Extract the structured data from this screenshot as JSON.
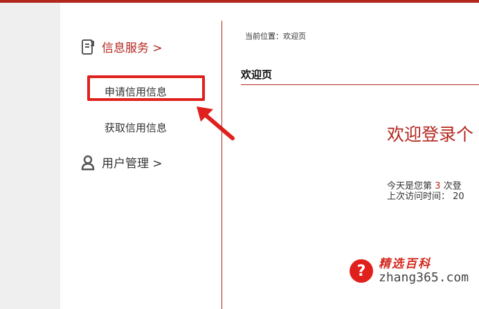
{
  "sidebar": {
    "groups": [
      {
        "label": "信息服务 >",
        "icon": "document-icon"
      },
      {
        "label": "用户管理 >",
        "icon": "user-icon"
      }
    ],
    "items": [
      {
        "label": "申请信用信息"
      },
      {
        "label": "获取信用信息"
      }
    ]
  },
  "main": {
    "breadcrumb": "当前位置：欢迎页",
    "page_title": "欢迎页",
    "welcome_heading": "欢迎登录个",
    "visit_prefix": "今天是您第",
    "visit_count": "3",
    "visit_suffix": "次登",
    "last_visit": "上次访问时间：  20"
  },
  "watermark": {
    "icon_glyph": "?",
    "brand_cn": "精选百科",
    "url": "zhang365.com"
  },
  "colors": {
    "accent": "#b3261e",
    "highlight": "#e0201c",
    "gutter": "#efefef"
  }
}
